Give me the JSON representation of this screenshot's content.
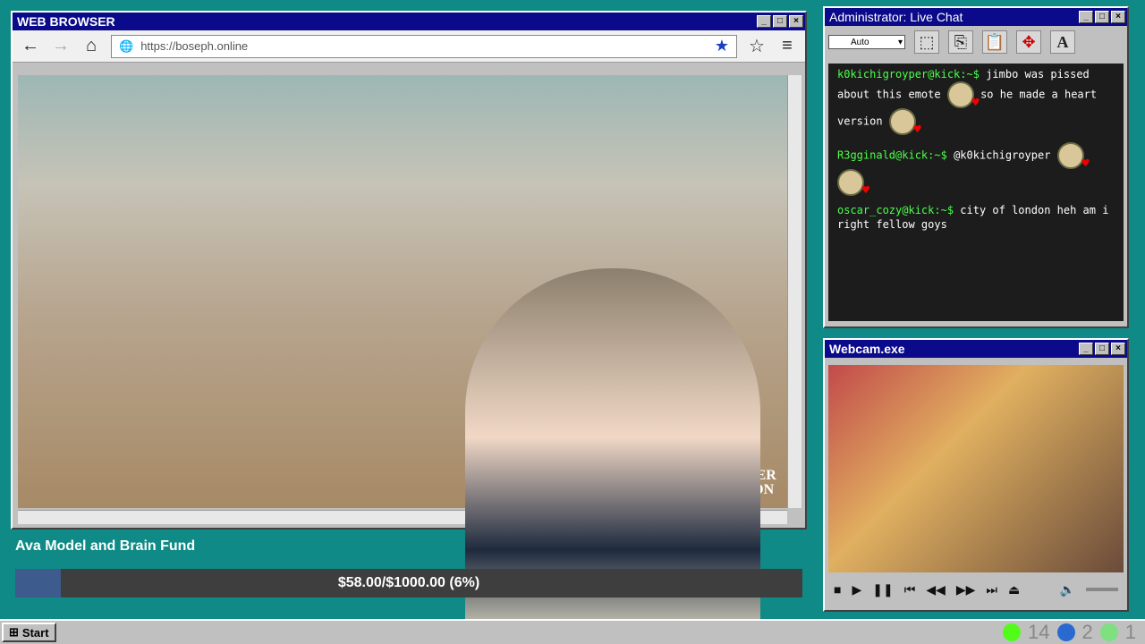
{
  "browser": {
    "title": "WEB BROWSER",
    "url": "https://boseph.online",
    "watermark": "UCKER RLSON"
  },
  "chat": {
    "title": "Administrator: Live Chat",
    "font_size_select": "Auto",
    "messages": [
      {
        "user": "k0kichigroyper@kick:~$",
        "text": "jimbo was pissed about this emote",
        "text2": "so he made a heart version"
      },
      {
        "user": "R3gginald@kick:~$",
        "text": "@k0kichigroyper"
      },
      {
        "user": "oscar_cozy@kick:~$",
        "text": "city of london heh am i right fellow goys"
      }
    ]
  },
  "webcam": {
    "title": "Webcam.exe"
  },
  "fund": {
    "label": "Ava Model and Brain Fund",
    "progress_text": "$58.00/$1000.00 (6%)",
    "progress_fraction": 0.058
  },
  "taskbar": {
    "start_label": "Start",
    "count1": "14",
    "count2": "2",
    "count3": "1"
  },
  "colors": {
    "desktop": "#0f8a86",
    "titlebar": "#0a0a8a",
    "chat_user": "#4cff4c",
    "fund_fill": "#3d5b8c"
  }
}
